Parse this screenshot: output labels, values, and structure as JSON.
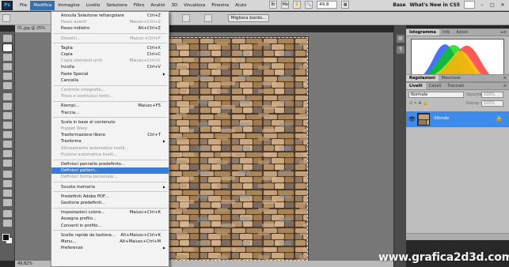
{
  "menubar": {
    "logo": "Ps",
    "items": [
      "File",
      "Modifica",
      "Immagine",
      "Livello",
      "Selezione",
      "Filtro",
      "Analisi",
      "3D",
      "Visualizza",
      "Finestra",
      "Aiuto"
    ],
    "zoom": "49,8",
    "workspace": "Base",
    "whats_new": "What's New in CS5"
  },
  "options": {
    "refine_edge": "Migliora bordo..."
  },
  "document": {
    "tab": "01.jpg @ 25%",
    "status_zoom": "49,82%"
  },
  "edit_menu": {
    "items": [
      {
        "label": "Annulla Selezione rettangolare",
        "shortcut": "Ctrl+Z",
        "disabled": false
      },
      {
        "label": "Passo avanti",
        "shortcut": "Maiusc+Ctrl+Z",
        "disabled": true
      },
      {
        "label": "Passo indietro",
        "shortcut": "Alt+Ctrl+Z",
        "disabled": false
      },
      {
        "sep": true
      },
      {
        "label": "Dissolvi...",
        "shortcut": "Maiusc+Ctrl+F",
        "disabled": true
      },
      {
        "sep": true
      },
      {
        "label": "Taglia",
        "shortcut": "Ctrl+X",
        "disabled": false
      },
      {
        "label": "Copia",
        "shortcut": "Ctrl+C",
        "disabled": false
      },
      {
        "label": "Copia elementi uniti",
        "shortcut": "Maiusc+Ctrl+C",
        "disabled": true
      },
      {
        "label": "Incolla",
        "shortcut": "Ctrl+V",
        "disabled": false
      },
      {
        "label": "Paste Special",
        "shortcut": "",
        "disabled": false,
        "submenu": true
      },
      {
        "label": "Cancella",
        "shortcut": "",
        "disabled": false
      },
      {
        "sep": true
      },
      {
        "label": "Controllo ortografia...",
        "shortcut": "",
        "disabled": true
      },
      {
        "label": "Trova e sostituisci testo...",
        "shortcut": "",
        "disabled": true
      },
      {
        "sep": true
      },
      {
        "label": "Riempi...",
        "shortcut": "Maiusc+F5",
        "disabled": false
      },
      {
        "label": "Traccia...",
        "shortcut": "",
        "disabled": false
      },
      {
        "sep": true
      },
      {
        "label": "Scala in base al contenuto",
        "shortcut": "",
        "disabled": false
      },
      {
        "label": "Puppet Warp",
        "shortcut": "",
        "disabled": true
      },
      {
        "label": "Trasformazione libera",
        "shortcut": "Ctrl+T",
        "disabled": false
      },
      {
        "label": "Trasforma",
        "shortcut": "",
        "disabled": false,
        "submenu": true
      },
      {
        "label": "Allineamento automatico livelli...",
        "shortcut": "",
        "disabled": true
      },
      {
        "label": "Fusione automatica livelli...",
        "shortcut": "",
        "disabled": true
      },
      {
        "sep": true
      },
      {
        "label": "Definisci pennello predefinito...",
        "shortcut": "",
        "disabled": false
      },
      {
        "label": "Definisci pattern...",
        "shortcut": "",
        "disabled": false,
        "highlighted": true
      },
      {
        "label": "Definisci forma personale...",
        "shortcut": "",
        "disabled": true
      },
      {
        "sep": true
      },
      {
        "label": "Svuota memoria",
        "shortcut": "",
        "disabled": false,
        "submenu": true
      },
      {
        "sep": true
      },
      {
        "label": "Predefiniti Adobe PDF...",
        "shortcut": "",
        "disabled": false
      },
      {
        "label": "Gestione predefiniti...",
        "shortcut": "",
        "disabled": false
      },
      {
        "sep": true
      },
      {
        "label": "Impostazioni colore...",
        "shortcut": "Maiusc+Ctrl+K",
        "disabled": false
      },
      {
        "label": "Assegna profilo...",
        "shortcut": "",
        "disabled": false
      },
      {
        "label": "Converti in profilo...",
        "shortcut": "",
        "disabled": false
      },
      {
        "sep": true
      },
      {
        "label": "Scelte rapide da tastiera...",
        "shortcut": "Alt+Maiusc+Ctrl+K",
        "disabled": false
      },
      {
        "label": "Menu...",
        "shortcut": "Alt+Maiusc+Ctrl+M",
        "disabled": false
      },
      {
        "label": "Preferenze",
        "shortcut": "",
        "disabled": false,
        "submenu": true
      }
    ]
  },
  "histogram_panel": {
    "tabs": [
      "Istogramma",
      "Info",
      "Azioni"
    ]
  },
  "adjust_panel": {
    "tabs": [
      "Regolazioni",
      "Maschere"
    ]
  },
  "layers_panel": {
    "tabs": [
      "Livelli",
      "Canali",
      "Tracciati"
    ],
    "blend_mode": "Normale",
    "opacity_label": "Opacità:",
    "opacity": "100%",
    "fill_label": "Riemp.:",
    "fill": "100%",
    "layer_name": "Sfondo"
  },
  "watermark": "www.grafica2d3d.com",
  "colors": {
    "menu_highlight": "#3b7cd6",
    "layer_selected": "#3d8bea"
  }
}
